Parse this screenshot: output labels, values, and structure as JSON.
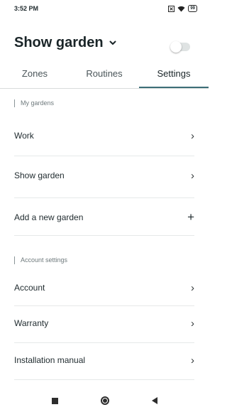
{
  "status_bar": {
    "time": "3:52 PM",
    "battery": "99"
  },
  "header": {
    "title": "Show garden",
    "dropdown_icon": "chevron-down-icon"
  },
  "tabs": [
    {
      "label": "Zones",
      "active": false
    },
    {
      "label": "Routines",
      "active": false
    },
    {
      "label": "Settings",
      "active": true
    }
  ],
  "sections": {
    "gardens": {
      "label": "My gardens",
      "items": [
        {
          "label": "Work",
          "icon": "chevron-right-icon",
          "glyph": "›"
        },
        {
          "label": "Show garden",
          "icon": "chevron-right-icon",
          "glyph": "›"
        },
        {
          "label": "Add a new garden",
          "icon": "plus-icon",
          "glyph": "+"
        }
      ]
    },
    "account": {
      "label": "Account settings",
      "items": [
        {
          "label": "Account",
          "icon": "chevron-right-icon",
          "glyph": "›"
        },
        {
          "label": "Warranty",
          "icon": "chevron-right-icon",
          "glyph": "›"
        },
        {
          "label": "Installation manual",
          "icon": "chevron-right-icon",
          "glyph": "›"
        }
      ]
    }
  },
  "colors": {
    "accent": "#3d6e78",
    "text": "#1f2a2e",
    "divider": "#e6e9e9"
  }
}
